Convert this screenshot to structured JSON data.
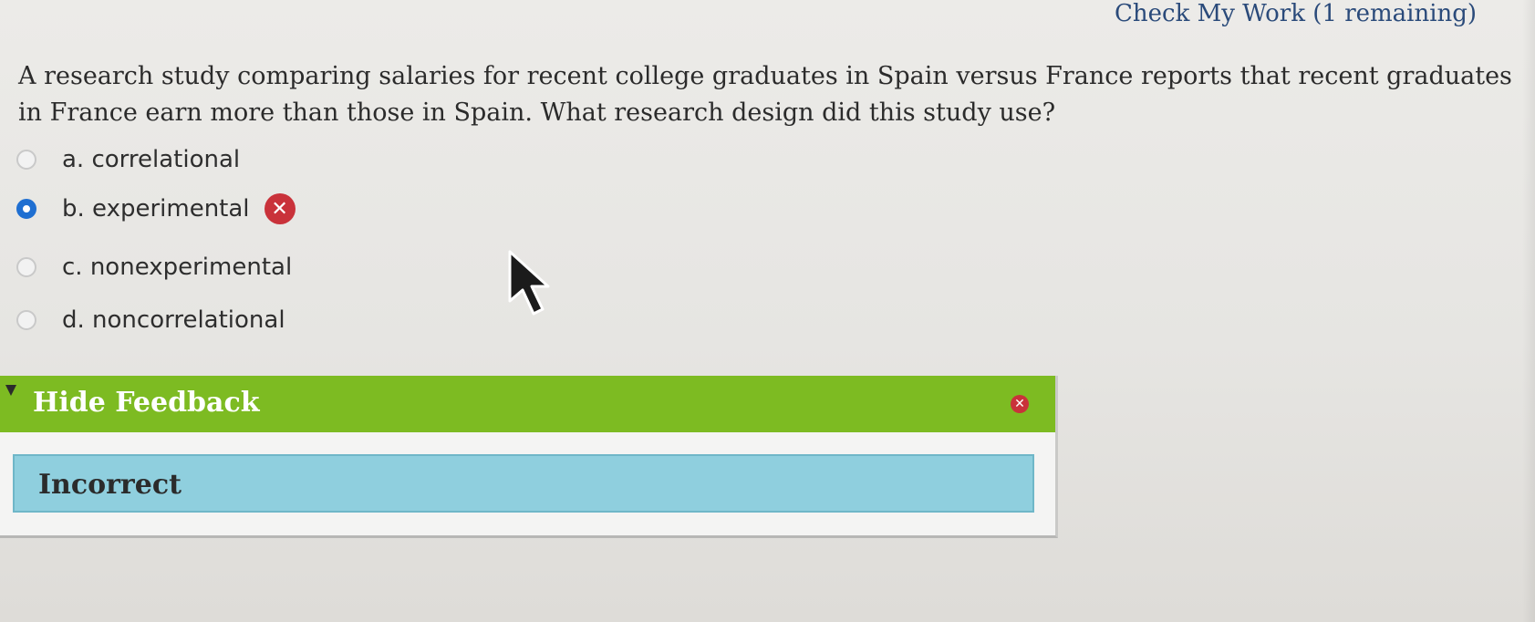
{
  "header": {
    "check_my_work": "Check My Work (1 remaining)"
  },
  "question": {
    "text": "A research study comparing salaries for recent college graduates in Spain versus France reports that recent graduates in France earn more than those in Spain. What research design did this study use?"
  },
  "options": [
    {
      "label": "a. correlational",
      "selected": false
    },
    {
      "label": "b. experimental",
      "selected": true,
      "status": "incorrect"
    },
    {
      "label": "c. nonexperimental",
      "selected": false
    },
    {
      "label": "d. noncorrelational",
      "selected": false
    }
  ],
  "feedback": {
    "toggle_label": "Hide Feedback",
    "result": "Incorrect",
    "header_color": "#7dbb22",
    "result_box_color": "#8fcfde"
  },
  "colors": {
    "selected_radio": "#1f6fd1",
    "incorrect_icon": "#c9323a",
    "link": "#2a4a7a"
  },
  "icons": {
    "incorrect": "x-circle-icon",
    "close": "close-icon",
    "collapse": "triangle-down-icon",
    "pointer": "mouse-cursor-icon"
  }
}
